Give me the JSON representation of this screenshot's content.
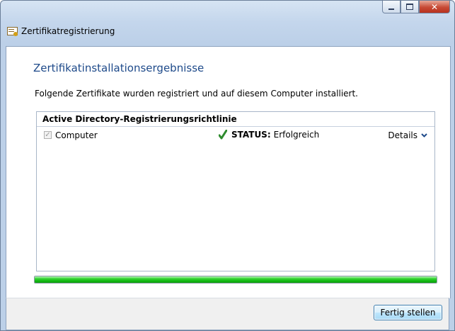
{
  "window": {
    "title": "Zertifikatregistrierung",
    "caption_buttons": {
      "minimize": "–",
      "maximize": "□",
      "close": "✕"
    }
  },
  "page": {
    "heading": "Zertifikatinstallationsergebnisse",
    "intro": "Folgende Zertifikate wurden registriert und auf diesem Computer installiert."
  },
  "policy": {
    "header": "Active Directory-Registrierungsrichtlinie",
    "items": [
      {
        "name": "Computer",
        "checked": true,
        "status_label": "STATUS:",
        "status_value": "Erfolgreich",
        "details_label": "Details"
      }
    ]
  },
  "progress": {
    "percent": 100,
    "color": "#1ec41e"
  },
  "footer": {
    "finish_button": "Fertig stellen"
  },
  "colors": {
    "heading": "#1e4a8a",
    "accent": "#1e4a8a",
    "success": "#2e8b2e"
  }
}
